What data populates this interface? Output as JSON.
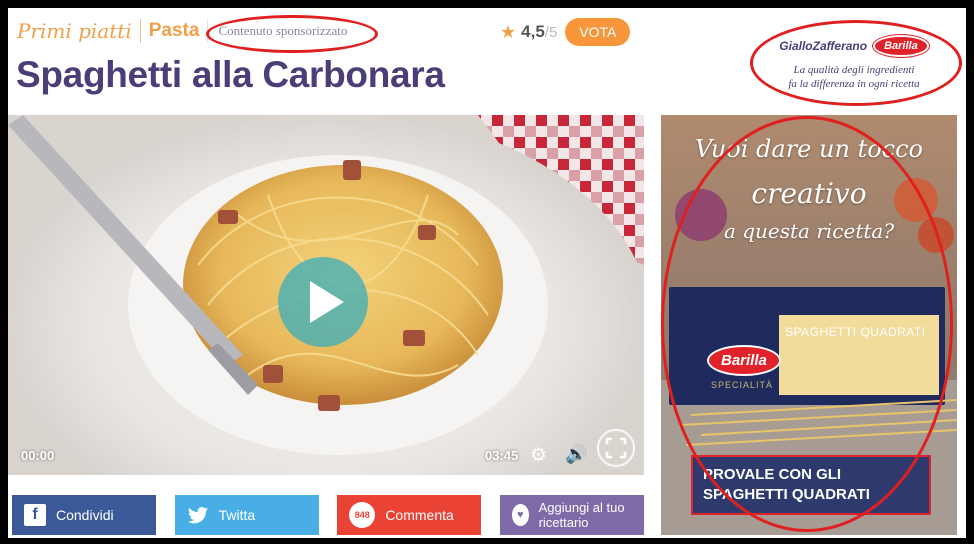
{
  "breadcrumb": {
    "category": "Primi piatti",
    "subcategory": "Pasta"
  },
  "sponsored_label": "Contenuto sponsorizzato",
  "rating": {
    "value": "4,5",
    "max": "/5",
    "vote_label": "VOTA"
  },
  "recipe_title": "Spaghetti alla Carbonara",
  "brand": {
    "logo_gz": "GialloZafferano",
    "logo_barilla": "Barilla",
    "claim_line1": "La qualità degli ingredienti",
    "claim_line2": "fa la differenza in ogni ricetta"
  },
  "video": {
    "current_time": "00:00",
    "duration": "03:45"
  },
  "share": {
    "facebook": "Condividi",
    "twitter": "Twitta",
    "comments_count": "848",
    "comment": "Commenta",
    "save": "Aggiungi al tuo ricettario"
  },
  "ad": {
    "headline_1": "Vuoi dare un tocco",
    "headline_2": "creativo",
    "headline_3": "a questa ricetta?",
    "product_brand": "Barilla",
    "product_name": "SPAGHETTI QUADRATI",
    "product_line": "SPECIALITÀ",
    "cta": "PROVALE CON GLI SPAGHETTI QUADRATI"
  },
  "colors": {
    "accent_orange": "#f7963a",
    "title_purple": "#4c3d78",
    "facebook": "#3b5998",
    "twitter": "#4aaee6",
    "comment": "#ea4335",
    "save": "#7f6aa8",
    "annotation_red": "#e01f1f"
  }
}
